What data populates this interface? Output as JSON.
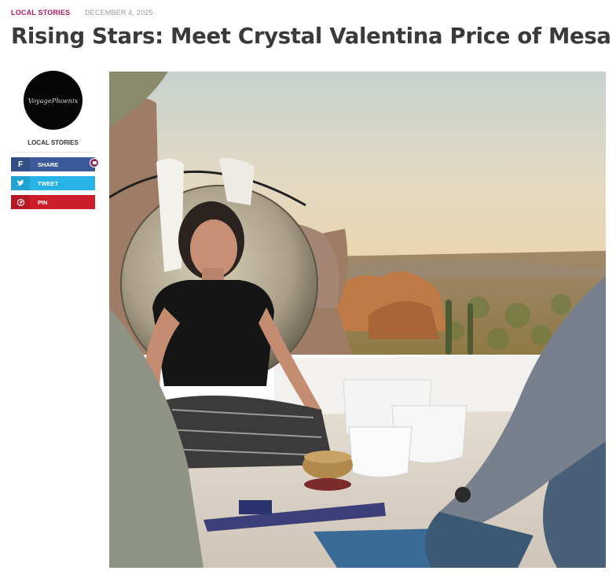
{
  "post": {
    "category": "LOCAL STORIES",
    "date": "DECEMBER 4, 2025",
    "title": "Rising Stars: Meet Crystal Valentina Price of Mesa"
  },
  "sidebar": {
    "logo_text": "VoyagePhoenix",
    "author_label": "LOCAL STORIES",
    "share": [
      {
        "label": "SHARE",
        "icon": "facebook-icon",
        "color": "#3b5998"
      },
      {
        "label": "TWEET",
        "icon": "twitter-icon",
        "color": "#27b3e6"
      },
      {
        "label": "PIN",
        "icon": "pinterest-icon",
        "color": "#cd1c2a"
      }
    ]
  }
}
